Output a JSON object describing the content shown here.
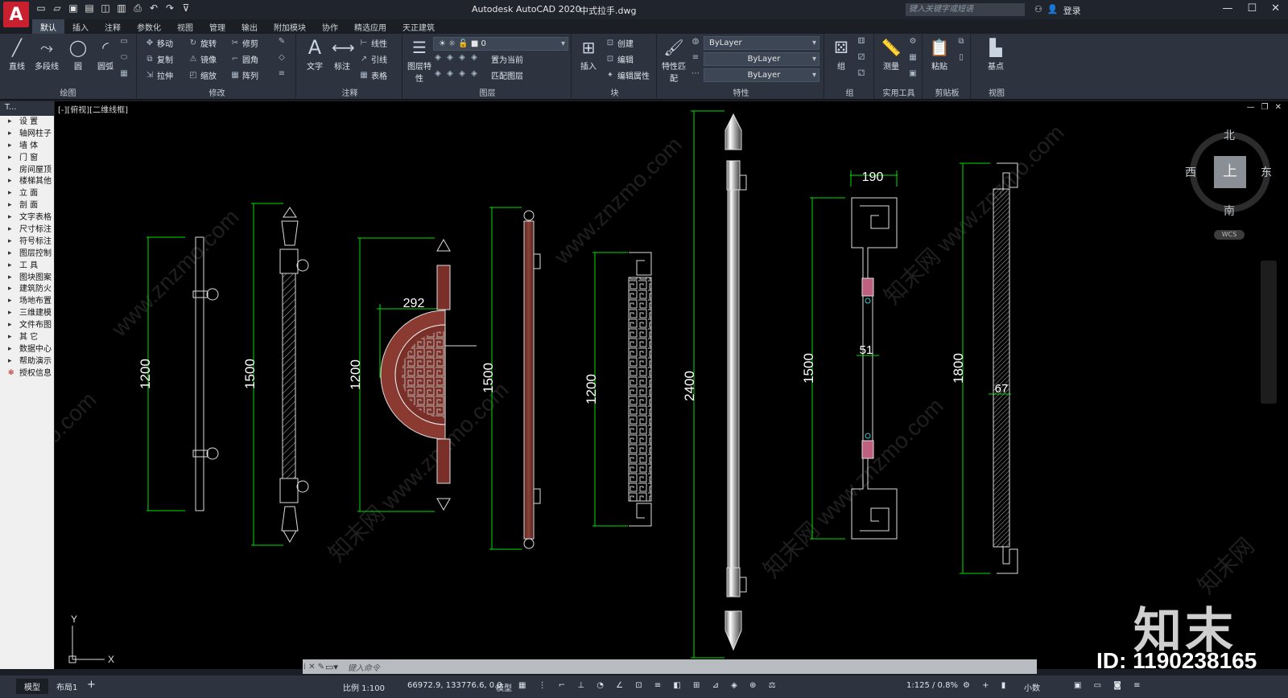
{
  "title": {
    "app_name": "Autodesk AutoCAD 2020",
    "file_name": "中式拉手.dwg",
    "search_placeholder": "键入关键字或短语",
    "login_label": "登录"
  },
  "ribbon": {
    "tabs": [
      "默认",
      "插入",
      "注释",
      "参数化",
      "视图",
      "管理",
      "输出",
      "附加模块",
      "协作",
      "精选应用",
      "天正建筑"
    ],
    "active_tab": "默认",
    "draw": {
      "label": "绘图",
      "line": "直线",
      "polyline": "多段线",
      "circle": "圆",
      "arc": "圆弧"
    },
    "modify": {
      "label": "修改",
      "move": "移动",
      "rotate": "旋转",
      "trim": "修剪",
      "copy": "复制",
      "mirror": "镜像",
      "fillet": "圆角",
      "stretch": "拉伸",
      "scale": "缩放",
      "array": "阵列"
    },
    "annotation": {
      "label": "注释",
      "text": "文字",
      "dimension": "标注",
      "linear": "线性",
      "leader": "引线",
      "table": "表格"
    },
    "layers": {
      "label": "图层",
      "layer_props": "图层特性",
      "current_layer": "0",
      "set_current": "置为当前",
      "match_layer": "匹配图层"
    },
    "block": {
      "label": "块",
      "insert": "插入",
      "create": "创建",
      "edit": "编辑",
      "edit_attr": "编辑属性"
    },
    "properties": {
      "label": "特性",
      "match": "特性匹配",
      "color": "ByLayer",
      "linetype": "ByLayer",
      "lineweight": "ByLayer"
    },
    "groups": {
      "label": "组",
      "group": "组"
    },
    "utilities": {
      "label": "实用工具",
      "measure": "测量"
    },
    "clipboard": {
      "label": "剪贴板",
      "paste": "粘贴"
    },
    "view": {
      "label": "视图",
      "base": "基点"
    }
  },
  "palette": {
    "header": "T...",
    "items": [
      "设 置",
      "轴网柱子",
      "墙 体",
      "门 窗",
      "房间屋顶",
      "楼梯其他",
      "立 面",
      "剖 面",
      "文字表格",
      "尺寸标注",
      "符号标注",
      "图层控制",
      "工 具",
      "图块图案",
      "建筑防火",
      "场地布置",
      "三维建模",
      "文件布图",
      "其 它",
      "数据中心",
      "帮助演示",
      "授权信息"
    ]
  },
  "viewport": {
    "label": "[-][俯视][二维线框]"
  },
  "viewcube": {
    "north": "北",
    "south": "南",
    "east": "东",
    "west": "西",
    "face": "上",
    "wcs": "WCS"
  },
  "ucs": {
    "x": "X",
    "y": "Y"
  },
  "drawing": {
    "dims": {
      "d1": "1200",
      "d2": "1500",
      "d3": "1200",
      "d3_width": "292",
      "d4": "1500",
      "d5": "1200",
      "d6": "2400",
      "d7": "1500",
      "d7_width": "190",
      "d7_inner": "51",
      "d8": "1800",
      "d8_inner": "67"
    }
  },
  "command": {
    "prompt": "键入命令"
  },
  "status": {
    "model_tab": "模型",
    "layout_tab": "布局1",
    "scale": "比例 1:100",
    "coords": "66972.9, 133776.6, 0.0",
    "space": "模型",
    "annot_scale": "1:125 / 0.8%",
    "units": "小数"
  },
  "watermark": {
    "brand": "知末",
    "id": "ID: 1190238165"
  }
}
